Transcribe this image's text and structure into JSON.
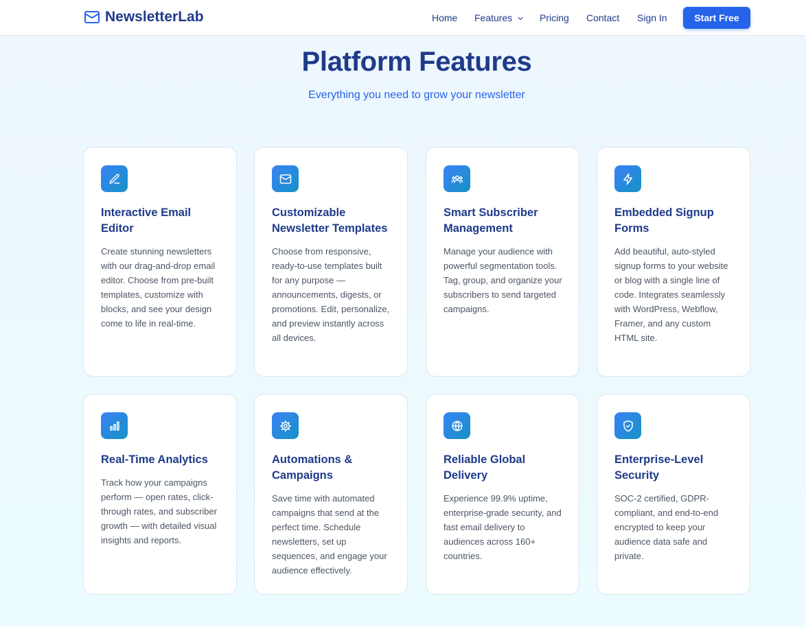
{
  "brand": {
    "name": "NewsletterLab",
    "icon": "mail-icon"
  },
  "nav": {
    "home": "Home",
    "features": "Features",
    "pricing": "Pricing",
    "contact": "Contact",
    "sign_in": "Sign In",
    "cta": "Start Free"
  },
  "hero": {
    "title": "Platform Features",
    "subtitle": "Everything you need to grow your newsletter"
  },
  "colors": {
    "accent": "#2563eb",
    "heading": "#1e3a8a",
    "body_text": "#4b5563"
  },
  "features": [
    {
      "icon": "edit-icon",
      "title": "Interactive Email Editor",
      "description": "Create stunning newsletters with our drag-and-drop email editor. Choose from pre-built templates, customize with blocks, and see your design come to life in real-time."
    },
    {
      "icon": "mail-icon",
      "title": "Customizable Newsletter Templates",
      "description": "Choose from responsive, ready-to-use templates built for any purpose — announcements, digests, or promotions. Edit, personalize, and preview instantly across all devices."
    },
    {
      "icon": "users-icon",
      "title": "Smart Subscriber Management",
      "description": "Manage your audience with powerful segmentation tools. Tag, group, and organize your subscribers to send targeted campaigns."
    },
    {
      "icon": "lightning-icon",
      "title": "Embedded Signup Forms",
      "description": "Add beautiful, auto-styled signup forms to your website or blog with a single line of code. Integrates seamlessly with WordPress, Webflow, Framer, and any custom HTML site."
    },
    {
      "icon": "bar-chart-icon",
      "title": "Real-Time Analytics",
      "description": "Track how your campaigns perform — open rates, click-through rates, and subscriber growth — with detailed visual insights and reports."
    },
    {
      "icon": "gear-icon",
      "title": "Automations & Campaigns",
      "description": "Save time with automated campaigns that send at the perfect time. Schedule newsletters, set up sequences, and engage your audience effectively."
    },
    {
      "icon": "globe-icon",
      "title": "Reliable Global Delivery",
      "description": "Experience 99.9% uptime, enterprise-grade security, and fast email delivery to audiences across 160+ countries."
    },
    {
      "icon": "shield-check-icon",
      "title": "Enterprise-Level Security",
      "description": "SOC-2 certified, GDPR-compliant, and end-to-end encrypted to keep your audience data safe and private."
    }
  ]
}
